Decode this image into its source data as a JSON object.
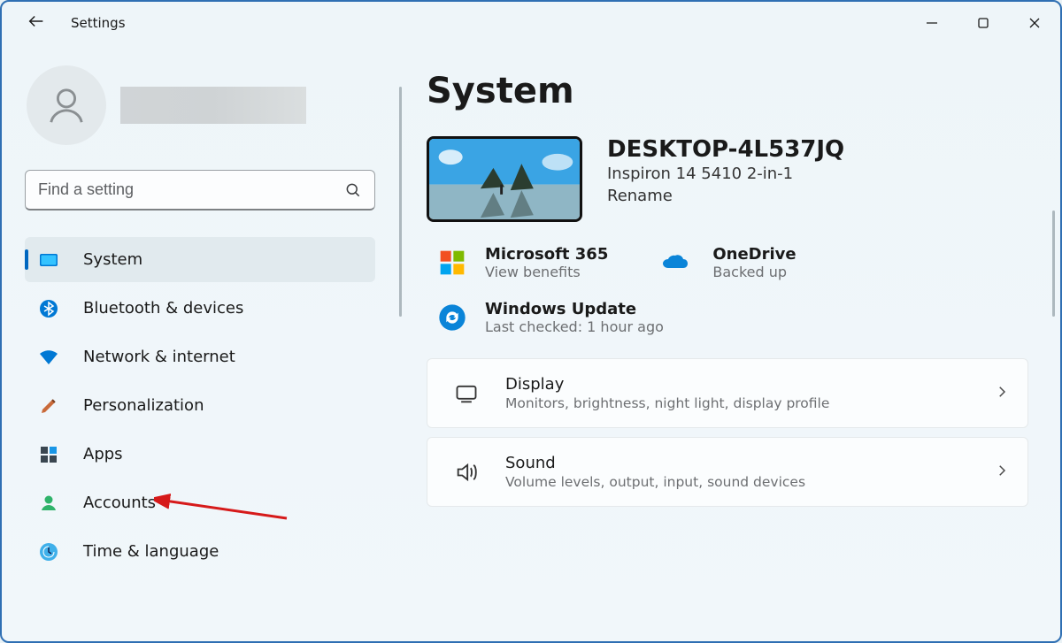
{
  "window": {
    "title": "Settings"
  },
  "search": {
    "placeholder": "Find a setting"
  },
  "nav": {
    "items": [
      {
        "label": "System"
      },
      {
        "label": "Bluetooth & devices"
      },
      {
        "label": "Network & internet"
      },
      {
        "label": "Personalization"
      },
      {
        "label": "Apps"
      },
      {
        "label": "Accounts"
      },
      {
        "label": "Time & language"
      }
    ]
  },
  "page": {
    "heading": "System",
    "device": {
      "name": "DESKTOP-4L537JQ",
      "model": "Inspiron 14 5410 2-in-1",
      "rename_label": "Rename"
    },
    "status": {
      "m365": {
        "title": "Microsoft 365",
        "subtitle": "View benefits"
      },
      "onedrive": {
        "title": "OneDrive",
        "subtitle": "Backed up"
      },
      "update": {
        "title": "Windows Update",
        "subtitle": "Last checked: 1 hour ago"
      }
    },
    "cards": [
      {
        "title": "Display",
        "subtitle": "Monitors, brightness, night light, display profile"
      },
      {
        "title": "Sound",
        "subtitle": "Volume levels, output, input, sound devices"
      }
    ]
  }
}
